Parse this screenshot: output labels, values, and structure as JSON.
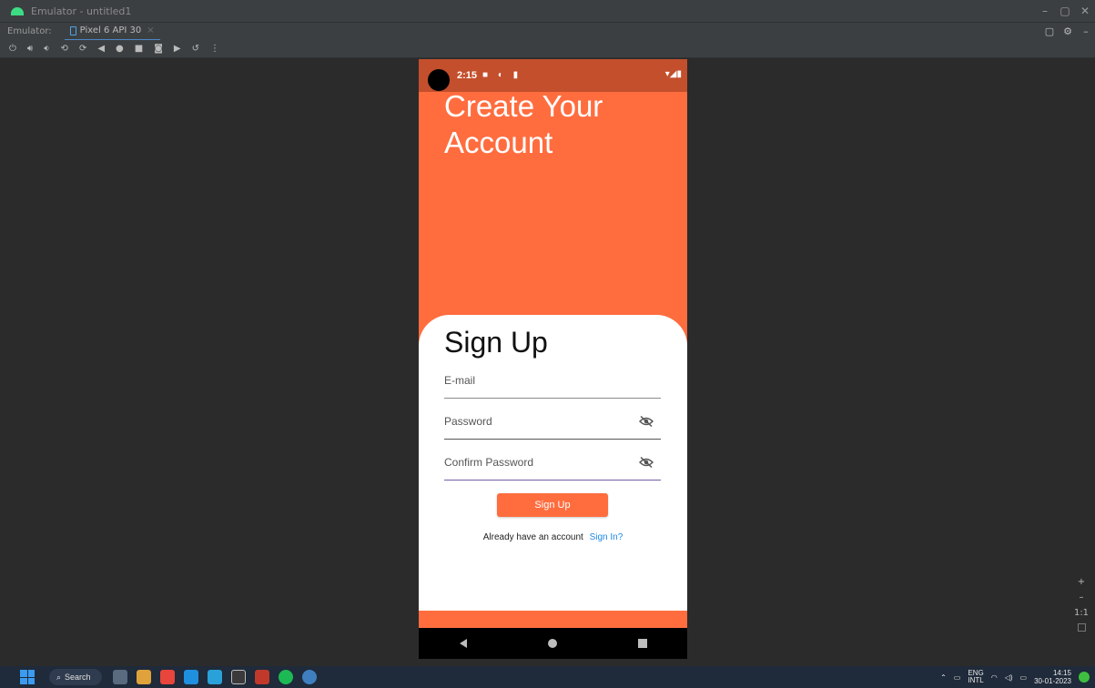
{
  "window": {
    "title": "Emulator - untitled1",
    "controls": [
      "–",
      "▢",
      "✕"
    ]
  },
  "tabs": {
    "label": "Emulator:",
    "active_tab": "Pixel 6 API 30",
    "close": "×"
  },
  "toolbar": {
    "icons": [
      "power-icon",
      "volume-up-icon",
      "volume-down-icon",
      "rotate-left-icon",
      "rotate-right-icon",
      "back-icon",
      "home-icon",
      "overview-icon",
      "screenshot-icon",
      "record-icon",
      "snapshot-icon",
      "more-icon"
    ]
  },
  "device": {
    "status": {
      "time": "2:15",
      "notification_icons": "■ ◐ ▮",
      "system_icons": "▾◢▮"
    },
    "headline_line1": "Create Your",
    "headline_line2": "Account",
    "form": {
      "title": "Sign Up",
      "email_placeholder": "E-mail",
      "password_placeholder": "Password",
      "confirm_placeholder": "Confirm Password",
      "submit_label": "Sign Up",
      "footer_text": "Already have an account",
      "signin_link": "Sign In?"
    },
    "colors": {
      "accent": "#ff6d3f",
      "status_bar": "#c34f2c",
      "link": "#1e88e5"
    }
  },
  "zoom": {
    "plus": "+",
    "minus": "–",
    "ratio": "1:1"
  },
  "taskbar": {
    "search_label": "Search",
    "lang_top": "ENG",
    "lang_bottom": "INTL",
    "time": "14:15",
    "date": "30-01-2023"
  }
}
